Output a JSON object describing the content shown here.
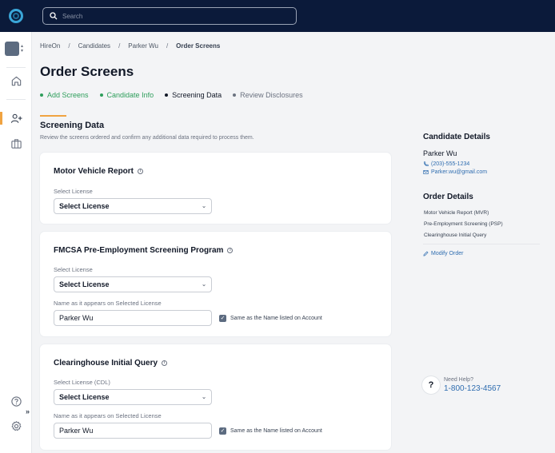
{
  "search": {
    "placeholder": "Search"
  },
  "breadcrumb": [
    "HireOn",
    "Candidates",
    "Parker Wu",
    "Order Screens"
  ],
  "page_title": "Order Screens",
  "steps": [
    {
      "label": "Add Screens",
      "state": "done"
    },
    {
      "label": "Candidate Info",
      "state": "done"
    },
    {
      "label": "Screening Data",
      "state": "current"
    },
    {
      "label": "Review Disclosures",
      "state": "todo"
    }
  ],
  "section": {
    "title": "Screening Data",
    "subtitle": "Review the screens ordered and confirm any additional data required to process them."
  },
  "cards": {
    "mvr": {
      "title": "Motor Vehicle Report",
      "license_label": "Select License",
      "license_value": "Select License"
    },
    "psp": {
      "title": "FMCSA Pre-Employment Screening Program",
      "license_label": "Select License",
      "license_value": "Select License",
      "name_label": "Name as it appears on Selected License",
      "name_value": "Parker Wu",
      "same_name_label": "Same as the Name listed on Account",
      "same_name_checked": true
    },
    "clearinghouse": {
      "title": "Clearinghouse Initial Query",
      "license_label": "Select License (CDL)",
      "license_value": "Select License",
      "name_label": "Name as it appears on Selected License",
      "name_value": "Parker Wu",
      "same_name_label": "Same as the Name listed on Account",
      "same_name_checked": true
    }
  },
  "candidate": {
    "heading": "Candidate Details",
    "name": "Parker Wu",
    "phone": "(203)-555-1234",
    "email": "Parker.wu@gmail.com"
  },
  "order": {
    "heading": "Order Details",
    "items": [
      "Motor Vehicle Report (MVR)",
      "Pre-Employment Screening (PSP)",
      "Clearinghouse Initial Query"
    ],
    "modify_label": "Modify Order"
  },
  "help": {
    "icon_text": "?",
    "label": "Need Help?",
    "phone": "1-800-123-4567"
  },
  "sidebar_expand": "»",
  "colors": {
    "topbar": "#0b1a3a",
    "accent": "#f0a341",
    "done_step": "#2e9e5b",
    "link": "#2f6db0"
  }
}
